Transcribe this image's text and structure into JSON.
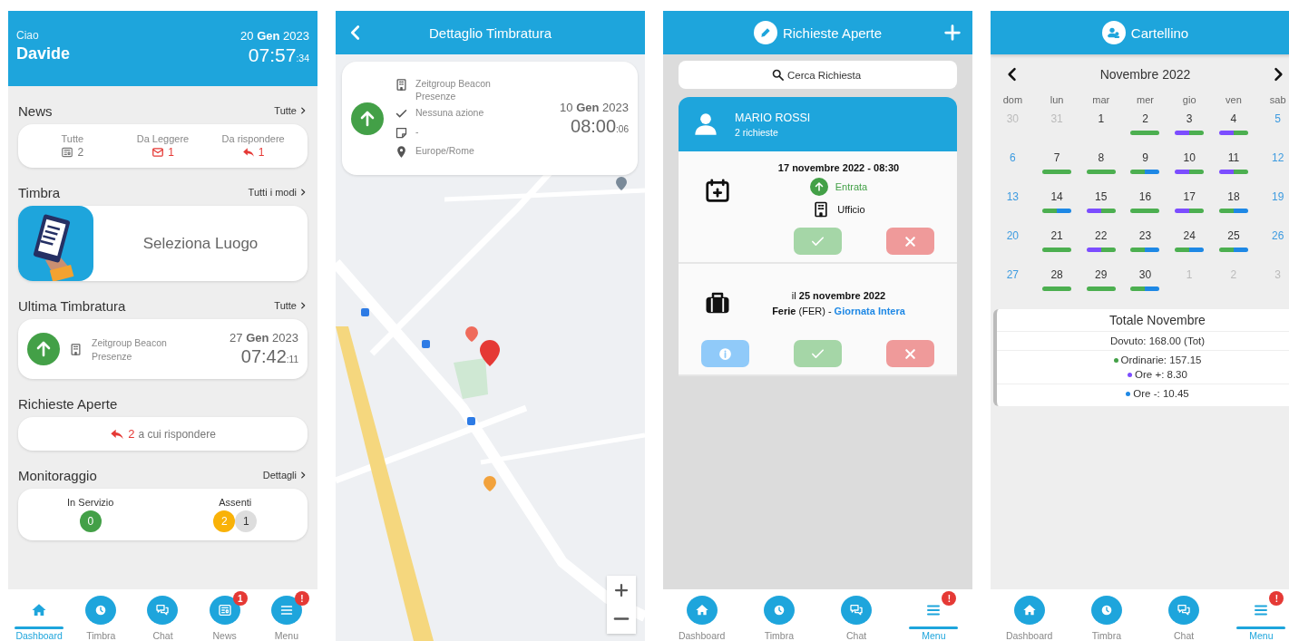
{
  "screens": [
    {
      "kind": "dashboard",
      "header": {
        "greeting": "Ciao",
        "name": "Davide",
        "date": "20 **Gen** 2023",
        "time": "07:57$_{:34}$"
      },
      "news": {
        "title": "News",
        "link": "Tutte",
        "stats": [
          {
            "kind": "all",
            "label": "Tutte",
            "count": "2"
          },
          {
            "kind": "unread",
            "label": "Da Leggere",
            "count": "1"
          },
          {
            "kind": "reply",
            "label": "Da rispondere",
            "count": "1"
          }
        ]
      },
      "timbra": {
        "title": "Timbra",
        "link": "Tutti i modi",
        "action": "Seleziona Luogo"
      },
      "last": {
        "title": "Ultima Timbratura",
        "link": "Tutte",
        "place": "Zeitgroup Beacon",
        "type": "Presenze",
        "date": "27 **Gen** 2023",
        "time": "07:42$_{:11}$"
      },
      "requests": {
        "title": "Richieste Aperte",
        "count": "2",
        "text": "a cui rispondere"
      },
      "monitor": {
        "title": "Monitoraggio",
        "link": "Dettagli",
        "groups": [
          {
            "label": "In Servizio",
            "counts": [
              {
                "value": "0",
                "color": "#43a047"
              }
            ]
          },
          {
            "label": "Assenti",
            "counts": [
              {
                "value": "2",
                "color": "#f9b208"
              },
              {
                "value": "1",
                "color": "#dddddd"
              }
            ]
          }
        ]
      },
      "nav": [
        {
          "kind": "dashboard",
          "label": "Dashboard",
          "selected": true
        },
        {
          "kind": "timbra",
          "label": "Timbra",
          "selected": false
        },
        {
          "kind": "chat",
          "label": "Chat",
          "selected": false
        },
        {
          "kind": "news",
          "label": "News",
          "selected": false,
          "badge": "1"
        },
        {
          "kind": "menu",
          "label": "Menu",
          "selected": false,
          "badge": "!"
        }
      ]
    },
    {
      "kind": "detail",
      "title": "Dettaglio Timbratura",
      "card": {
        "lines": [
          {
            "kind": "building",
            "text": "Zeitgroup Beacon",
            "sub": "Presenze"
          },
          {
            "kind": "check",
            "text": "Nessuna azione"
          },
          {
            "kind": "note",
            "text": "-"
          },
          {
            "kind": "pin",
            "text": "Europe/Rome"
          }
        ],
        "date": "10 **Gen** 2023",
        "time": "08:00$_{:06}$"
      }
    },
    {
      "kind": "requests",
      "title": "Richieste Aperte",
      "search": {
        "placeholder": "Cerca Richiesta"
      },
      "person": {
        "name": "MARIO ROSSI",
        "summary": "2 richieste"
      },
      "items": [
        {
          "kind": "punch",
          "title": "17 novembre 2022 - 08:30",
          "direction": "Entrata",
          "place": "Ufficio",
          "buttons": [
            {
              "kind": "approve"
            },
            {
              "kind": "reject"
            }
          ]
        },
        {
          "kind": "leave",
          "date": "il **25 novembre 2022**",
          "type": "**Ferie** (FER) -",
          "period": "Giornata Intera",
          "buttons": [
            {
              "kind": "info"
            },
            {
              "kind": "approve"
            },
            {
              "kind": "reject"
            }
          ]
        }
      ],
      "nav": [
        {
          "kind": "dashboard",
          "label": "Dashboard",
          "selected": false
        },
        {
          "kind": "timbra",
          "label": "Timbra",
          "selected": false
        },
        {
          "kind": "chat",
          "label": "Chat",
          "selected": false
        },
        {
          "kind": "menu",
          "label": "Menu",
          "selected": true,
          "badge": "!"
        }
      ]
    },
    {
      "kind": "timecard",
      "title": "Cartellino",
      "month": "Novembre 2022",
      "weekdays": [
        "dom",
        "lun",
        "mar",
        "mer",
        "gio",
        "ven",
        "sab"
      ],
      "weeks": [
        [
          {
            "day": "30",
            "kind": "other"
          },
          {
            "day": "31",
            "kind": "other"
          },
          {
            "day": "1",
            "kind": "day"
          },
          {
            "day": "2",
            "kind": "day",
            "segments": [
              {
                "color": "#4caf50"
              }
            ]
          },
          {
            "day": "3",
            "kind": "day",
            "segments": [
              {
                "color": "#7c4dff"
              },
              {
                "color": "#4caf50"
              }
            ]
          },
          {
            "day": "4",
            "kind": "day",
            "segments": [
              {
                "color": "#7c4dff"
              },
              {
                "color": "#4caf50"
              }
            ]
          },
          {
            "day": "5",
            "kind": "weekend"
          }
        ],
        [
          {
            "day": "6",
            "kind": "weekend"
          },
          {
            "day": "7",
            "kind": "day",
            "segments": [
              {
                "color": "#4caf50"
              }
            ]
          },
          {
            "day": "8",
            "kind": "day",
            "segments": [
              {
                "color": "#4caf50"
              }
            ]
          },
          {
            "day": "9",
            "kind": "day",
            "segments": [
              {
                "color": "#4caf50"
              },
              {
                "color": "#1e88e5"
              }
            ]
          },
          {
            "day": "10",
            "kind": "day",
            "segments": [
              {
                "color": "#7c4dff"
              },
              {
                "color": "#4caf50"
              }
            ]
          },
          {
            "day": "11",
            "kind": "day",
            "segments": [
              {
                "color": "#7c4dff"
              },
              {
                "color": "#4caf50"
              }
            ]
          },
          {
            "day": "12",
            "kind": "weekend"
          }
        ],
        [
          {
            "day": "13",
            "kind": "weekend"
          },
          {
            "day": "14",
            "kind": "day",
            "segments": [
              {
                "color": "#4caf50"
              },
              {
                "color": "#1e88e5"
              }
            ]
          },
          {
            "day": "15",
            "kind": "day",
            "segments": [
              {
                "color": "#7c4dff"
              },
              {
                "color": "#4caf50"
              }
            ]
          },
          {
            "day": "16",
            "kind": "day",
            "segments": [
              {
                "color": "#4caf50"
              }
            ]
          },
          {
            "day": "17",
            "kind": "day",
            "segments": [
              {
                "color": "#7c4dff"
              },
              {
                "color": "#4caf50"
              }
            ]
          },
          {
            "day": "18",
            "kind": "day",
            "segments": [
              {
                "color": "#4caf50"
              },
              {
                "color": "#1e88e5"
              }
            ]
          },
          {
            "day": "19",
            "kind": "weekend"
          }
        ],
        [
          {
            "day": "20",
            "kind": "weekend"
          },
          {
            "day": "21",
            "kind": "day",
            "segments": [
              {
                "color": "#4caf50"
              }
            ]
          },
          {
            "day": "22",
            "kind": "day",
            "segments": [
              {
                "color": "#7c4dff"
              },
              {
                "color": "#4caf50"
              }
            ]
          },
          {
            "day": "23",
            "kind": "day",
            "segments": [
              {
                "color": "#4caf50"
              },
              {
                "color": "#1e88e5"
              }
            ]
          },
          {
            "day": "24",
            "kind": "day",
            "segments": [
              {
                "color": "#4caf50"
              },
              {
                "color": "#1e88e5"
              }
            ]
          },
          {
            "day": "25",
            "kind": "day",
            "segments": [
              {
                "color": "#4caf50"
              },
              {
                "color": "#1e88e5"
              }
            ]
          },
          {
            "day": "26",
            "kind": "weekend"
          }
        ],
        [
          {
            "day": "27",
            "kind": "weekend"
          },
          {
            "day": "28",
            "kind": "day",
            "segments": [
              {
                "color": "#4caf50"
              }
            ]
          },
          {
            "day": "29",
            "kind": "day",
            "segments": [
              {
                "color": "#4caf50"
              }
            ]
          },
          {
            "day": "30",
            "kind": "day",
            "segments": [
              {
                "color": "#4caf50"
              },
              {
                "color": "#1e88e5"
              }
            ]
          },
          {
            "day": "1",
            "kind": "other"
          },
          {
            "day": "2",
            "kind": "other"
          },
          {
            "day": "3",
            "kind": "other"
          }
        ]
      ],
      "totals": {
        "title": "Totale Novembre",
        "sections": [
          {
            "rows": [
              {
                "text": "Dovuto: 168.00 (Tot)"
              }
            ]
          },
          {
            "rows": [
              {
                "text": "Ordinarie: 157.15",
                "color": "#43a047"
              },
              {
                "text": "Ore +: 8.30",
                "color": "#7c4dff"
              }
            ]
          },
          {
            "rows": [
              {
                "text": "Ore -: 10.45",
                "color": "#1e88e5"
              }
            ]
          }
        ]
      },
      "nav": [
        {
          "kind": "dashboard",
          "label": "Dashboard",
          "selected": false
        },
        {
          "kind": "timbra",
          "label": "Timbra",
          "selected": false
        },
        {
          "kind": "chat",
          "label": "Chat",
          "selected": false
        },
        {
          "kind": "menu",
          "label": "Menu",
          "selected": true,
          "badge": "!"
        }
      ]
    }
  ]
}
